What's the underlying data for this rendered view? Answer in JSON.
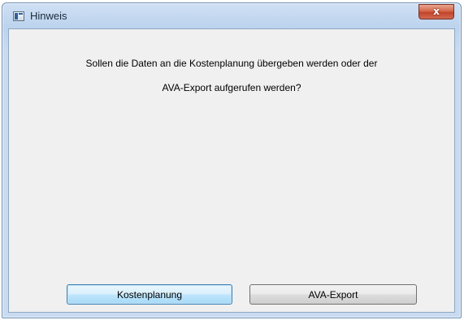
{
  "window": {
    "title": "Hinweis",
    "close_glyph": "x",
    "icon": "application-icon"
  },
  "dialog": {
    "message_line1": "Sollen die Daten an die Kostenplanung übergeben werden oder der",
    "message_line2": "AVA-Export aufgerufen werden?"
  },
  "buttons": {
    "kostenplanung_label": "Kostenplanung",
    "ava_export_label": "AVA-Export"
  },
  "colors": {
    "frame": "#bcd3ee",
    "close": "#c2432a",
    "default_button": "#bee6fd",
    "client": "#f0f0f0"
  }
}
